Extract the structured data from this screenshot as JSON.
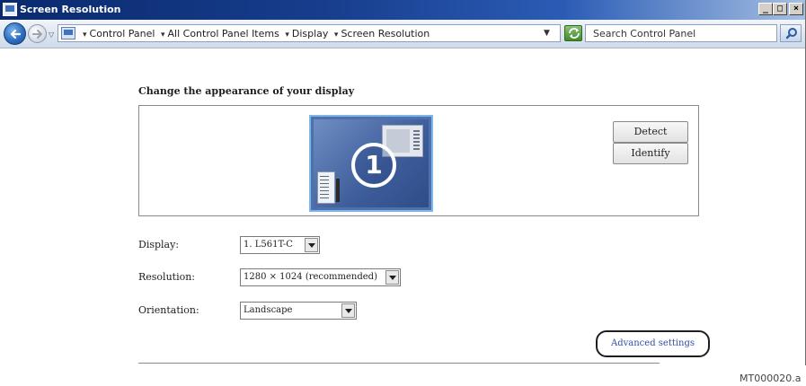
{
  "window": {
    "title": "Screen Resolution",
    "buttons": {
      "minimize": "_",
      "maximize": "□",
      "close": "×"
    }
  },
  "address_bar": {
    "breadcrumbs": [
      "Control Panel",
      "All Control Panel Items",
      "Display",
      "Screen Resolution"
    ],
    "search_placeholder": "Search Control Panel"
  },
  "content": {
    "heading": "Change the appearance of your display",
    "monitor_number": "1",
    "detect_label": "Detect",
    "identify_label": "Identify",
    "display_label": "Display:",
    "display_value": "1. L561T-C",
    "resolution_label": "Resolution:",
    "resolution_value": "1280 × 1024 (recommended)",
    "orientation_label": "Orientation:",
    "orientation_value": "Landscape",
    "advanced_settings": "Advanced settings"
  },
  "figure_ref": "MT000020.a",
  "colors": {
    "title_bar": "#0a2a6e",
    "link": "#2f4fa6",
    "monitor": "#4e71ab"
  }
}
